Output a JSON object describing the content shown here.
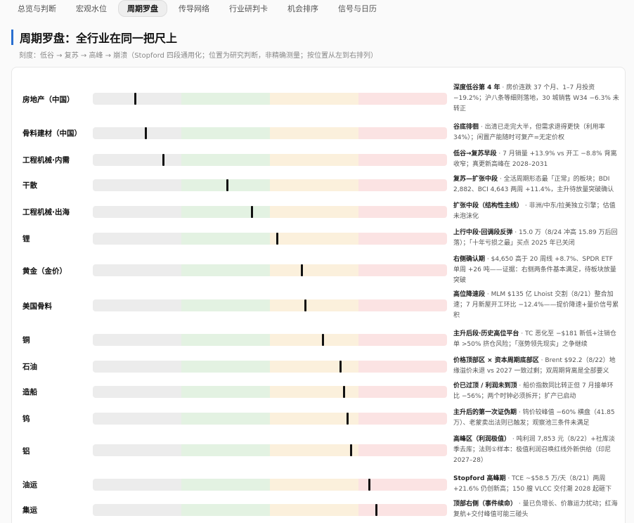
{
  "tabs": [
    {
      "label": "总览与判断",
      "active": false
    },
    {
      "label": "宏观水位",
      "active": false
    },
    {
      "label": "周期罗盘",
      "active": true
    },
    {
      "label": "传导网络",
      "active": false
    },
    {
      "label": "行业研判卡",
      "active": false
    },
    {
      "label": "机会排序",
      "active": false
    },
    {
      "label": "信号与日历",
      "active": false
    }
  ],
  "header": {
    "title": "周期罗盘：全行业在同一把尺上",
    "subtitle": "刻度：低谷 → 复苏 → 高峰 → 崩溃（Stopford 四段通用化；位置为研究判断，非精确测量；按位置从左到右排列）"
  },
  "colors": {
    "accent": "#2a6fd0",
    "trough": "#ececec",
    "recovery": "#e3f2e2",
    "peak": "#fbf0dc",
    "collapse": "#fbe3e3",
    "marker": "#111111"
  },
  "rows": [
    {
      "label": "房地产（中国）",
      "position": 0.12,
      "stage": "深度低谷第 4 年",
      "detail": " · 房价连跌 37 个月、1–7 月投资 −19.2%；沪八条等细则落地，30 城销售 W34 −6.3% 未转正"
    },
    {
      "label": "骨料建材（中国）",
      "position": 0.15,
      "stage": "谷底徘徊",
      "detail": " · 出清已走完大半，但需求退得更快（利用率 34%）；闲置产能随时可复产=无定价权"
    },
    {
      "label": "工程机械·内需",
      "position": 0.2,
      "stage": "低谷→复苏早段",
      "detail": " · 7 月销量 +13.9% vs 开工 −8.8% 背离收窄；真更新高峰在 2028–2031"
    },
    {
      "label": "干散",
      "position": 0.38,
      "stage": "复苏—扩张中段",
      "detail": " · 全活周期形态最「正常」的板块；BDI 2,882、BCI 4,643 两周 +11.4%，主升待放量突破确认"
    },
    {
      "label": "工程机械·出海",
      "position": 0.45,
      "stage": "扩张中段（结构性主线）",
      "detail": " · 非洲/中东/拉美独立引擎；估值未泡沫化"
    },
    {
      "label": "锂",
      "position": 0.52,
      "stage": "上行中段·回调段反弹",
      "detail": " · 15.0 万（8/24 冲高 15.89 万后回落）；「十年亏损之最」买点 2025 年已关闭"
    },
    {
      "label": "黄金（金价）",
      "position": 0.59,
      "stage": "右侧确认期",
      "detail": " · $4,650 高于 20 周线 +8.7%、SPDR ETF 单周 +26 吨——证据：右侧两条件基本满足，待板块放量突破"
    },
    {
      "label": "美国骨料",
      "position": 0.6,
      "stage": "高位降速段",
      "detail": " · MLM $135 亿 Lhoist 交割（8/21）整合加速；7 月新屋开工环比 −12.4%——提价降速+量价信号累积"
    },
    {
      "label": "铜",
      "position": 0.65,
      "stage": "主升后段·历史高位平台",
      "detail": " · TC 恶化至 −$181 新低+注销仓单 >50% 挤仓风险；「涨势领先现实」之争继续"
    },
    {
      "label": "石油",
      "position": 0.7,
      "stage": "价格顶部区 × 资本周期底部区",
      "detail": " · Brent $92.2（8/22）地缘溢价未退 vs 2027 一致过剩；双周期背离是全部要义"
    },
    {
      "label": "造船",
      "position": 0.71,
      "stage": "价已过顶 / 利润未到顶",
      "detail": " · 船价指数同比转正但 7 月接单环比 −56%；两个时钟必须拆开；扩产已启动"
    },
    {
      "label": "钨",
      "position": 0.72,
      "stage": "主升后的第一次证伪期",
      "detail": " · 钨价较峰值 −60% 横盘（41.85 万）、老蒙卖出法则已触发；观察池三条件未满足"
    },
    {
      "label": "铝",
      "position": 0.73,
      "stage": "高峰区（利润极值）",
      "detail": " · 吨利润 7,853 元（8/22）+社库淡季去库；法则①样本：极值利润召唤红线外新供给（印尼 2027–28）"
    },
    {
      "label": "油运",
      "position": 0.78,
      "stage": "Stopford 高峰期",
      "detail": " · TCE ~$58.5 万/天（8/21）两周 +21.6% 仍创新高；150 艘 VLCC 交付潮 2028 起砸下"
    },
    {
      "label": "集运",
      "position": 0.8,
      "stage": "顶部右侧（事件续命）",
      "detail": " · 量已负增长、价靠运力扰动；红海复航+交付峰值可能三碰头"
    }
  ]
}
